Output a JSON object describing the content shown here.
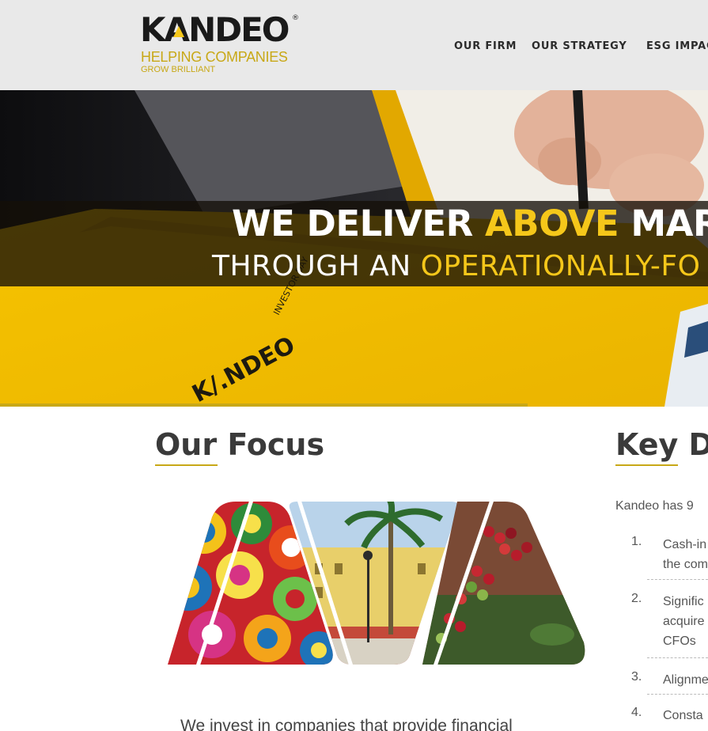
{
  "brand": {
    "name_left": "K",
    "name_a": "A",
    "name_right": "NDEO",
    "registered": "®",
    "tagline_line1": "HELPING COMPANIES",
    "tagline_line2": "GROW BRILLIANT",
    "accent_color": "#c8a817"
  },
  "nav": {
    "items": [
      {
        "label": "OUR FIRM"
      },
      {
        "label": "OUR STRATEGY"
      },
      {
        "label": "ESG IMPAC"
      }
    ]
  },
  "hero": {
    "line1_white": "WE DELIVER ",
    "line1_yellow": "ABOVE",
    "line1_white2": " MAR",
    "line2_white": "THROUGH AN ",
    "line2_yellow": "OPERATIONALLY-FO",
    "notebook_brand": "K/.NDEO",
    "notebook_label": "INVESTOR DAY",
    "slide_progress": 0.745
  },
  "focus": {
    "title_underlined": "Our",
    "title_rest": " Focus",
    "body_text": "We invest in companies that provide financial"
  },
  "key": {
    "title_underlined": "Key",
    "title_rest": " D",
    "intro": "Kandeo has 9",
    "items": [
      {
        "num": "1.",
        "lines": [
          "Cash-in",
          "the com"
        ]
      },
      {
        "num": "2.",
        "lines": [
          "Signific",
          "acquire",
          "CFOs"
        ]
      },
      {
        "num": "3.",
        "lines": [
          "Alignme"
        ]
      },
      {
        "num": "4.",
        "lines": [
          "Consta"
        ]
      }
    ]
  }
}
